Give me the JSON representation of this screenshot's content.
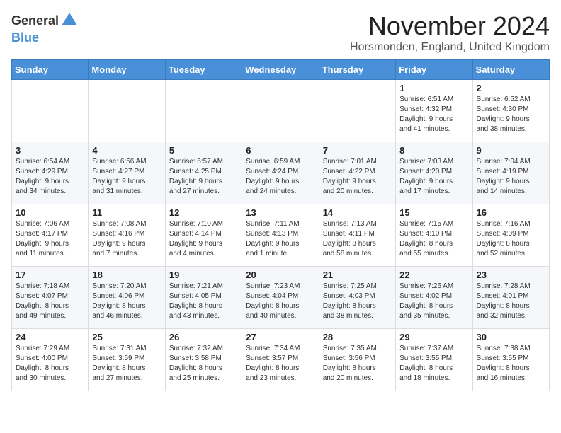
{
  "logo": {
    "general": "General",
    "blue": "Blue"
  },
  "title": "November 2024",
  "location": "Horsmonden, England, United Kingdom",
  "weekdays": [
    "Sunday",
    "Monday",
    "Tuesday",
    "Wednesday",
    "Thursday",
    "Friday",
    "Saturday"
  ],
  "weeks": [
    [
      {
        "day": "",
        "info": ""
      },
      {
        "day": "",
        "info": ""
      },
      {
        "day": "",
        "info": ""
      },
      {
        "day": "",
        "info": ""
      },
      {
        "day": "",
        "info": ""
      },
      {
        "day": "1",
        "info": "Sunrise: 6:51 AM\nSunset: 4:32 PM\nDaylight: 9 hours\nand 41 minutes."
      },
      {
        "day": "2",
        "info": "Sunrise: 6:52 AM\nSunset: 4:30 PM\nDaylight: 9 hours\nand 38 minutes."
      }
    ],
    [
      {
        "day": "3",
        "info": "Sunrise: 6:54 AM\nSunset: 4:29 PM\nDaylight: 9 hours\nand 34 minutes."
      },
      {
        "day": "4",
        "info": "Sunrise: 6:56 AM\nSunset: 4:27 PM\nDaylight: 9 hours\nand 31 minutes."
      },
      {
        "day": "5",
        "info": "Sunrise: 6:57 AM\nSunset: 4:25 PM\nDaylight: 9 hours\nand 27 minutes."
      },
      {
        "day": "6",
        "info": "Sunrise: 6:59 AM\nSunset: 4:24 PM\nDaylight: 9 hours\nand 24 minutes."
      },
      {
        "day": "7",
        "info": "Sunrise: 7:01 AM\nSunset: 4:22 PM\nDaylight: 9 hours\nand 20 minutes."
      },
      {
        "day": "8",
        "info": "Sunrise: 7:03 AM\nSunset: 4:20 PM\nDaylight: 9 hours\nand 17 minutes."
      },
      {
        "day": "9",
        "info": "Sunrise: 7:04 AM\nSunset: 4:19 PM\nDaylight: 9 hours\nand 14 minutes."
      }
    ],
    [
      {
        "day": "10",
        "info": "Sunrise: 7:06 AM\nSunset: 4:17 PM\nDaylight: 9 hours\nand 11 minutes."
      },
      {
        "day": "11",
        "info": "Sunrise: 7:08 AM\nSunset: 4:16 PM\nDaylight: 9 hours\nand 7 minutes."
      },
      {
        "day": "12",
        "info": "Sunrise: 7:10 AM\nSunset: 4:14 PM\nDaylight: 9 hours\nand 4 minutes."
      },
      {
        "day": "13",
        "info": "Sunrise: 7:11 AM\nSunset: 4:13 PM\nDaylight: 9 hours\nand 1 minute."
      },
      {
        "day": "14",
        "info": "Sunrise: 7:13 AM\nSunset: 4:11 PM\nDaylight: 8 hours\nand 58 minutes."
      },
      {
        "day": "15",
        "info": "Sunrise: 7:15 AM\nSunset: 4:10 PM\nDaylight: 8 hours\nand 55 minutes."
      },
      {
        "day": "16",
        "info": "Sunrise: 7:16 AM\nSunset: 4:09 PM\nDaylight: 8 hours\nand 52 minutes."
      }
    ],
    [
      {
        "day": "17",
        "info": "Sunrise: 7:18 AM\nSunset: 4:07 PM\nDaylight: 8 hours\nand 49 minutes."
      },
      {
        "day": "18",
        "info": "Sunrise: 7:20 AM\nSunset: 4:06 PM\nDaylight: 8 hours\nand 46 minutes."
      },
      {
        "day": "19",
        "info": "Sunrise: 7:21 AM\nSunset: 4:05 PM\nDaylight: 8 hours\nand 43 minutes."
      },
      {
        "day": "20",
        "info": "Sunrise: 7:23 AM\nSunset: 4:04 PM\nDaylight: 8 hours\nand 40 minutes."
      },
      {
        "day": "21",
        "info": "Sunrise: 7:25 AM\nSunset: 4:03 PM\nDaylight: 8 hours\nand 38 minutes."
      },
      {
        "day": "22",
        "info": "Sunrise: 7:26 AM\nSunset: 4:02 PM\nDaylight: 8 hours\nand 35 minutes."
      },
      {
        "day": "23",
        "info": "Sunrise: 7:28 AM\nSunset: 4:01 PM\nDaylight: 8 hours\nand 32 minutes."
      }
    ],
    [
      {
        "day": "24",
        "info": "Sunrise: 7:29 AM\nSunset: 4:00 PM\nDaylight: 8 hours\nand 30 minutes."
      },
      {
        "day": "25",
        "info": "Sunrise: 7:31 AM\nSunset: 3:59 PM\nDaylight: 8 hours\nand 27 minutes."
      },
      {
        "day": "26",
        "info": "Sunrise: 7:32 AM\nSunset: 3:58 PM\nDaylight: 8 hours\nand 25 minutes."
      },
      {
        "day": "27",
        "info": "Sunrise: 7:34 AM\nSunset: 3:57 PM\nDaylight: 8 hours\nand 23 minutes."
      },
      {
        "day": "28",
        "info": "Sunrise: 7:35 AM\nSunset: 3:56 PM\nDaylight: 8 hours\nand 20 minutes."
      },
      {
        "day": "29",
        "info": "Sunrise: 7:37 AM\nSunset: 3:55 PM\nDaylight: 8 hours\nand 18 minutes."
      },
      {
        "day": "30",
        "info": "Sunrise: 7:38 AM\nSunset: 3:55 PM\nDaylight: 8 hours\nand 16 minutes."
      }
    ]
  ]
}
